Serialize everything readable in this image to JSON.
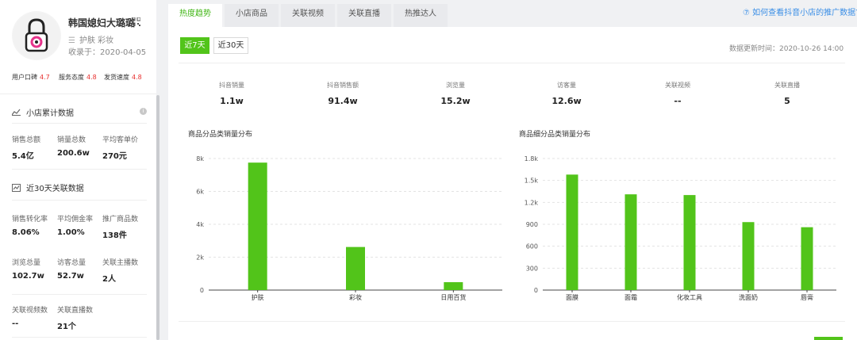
{
  "shop": {
    "name": "韩国媳妇大璐璐",
    "categories": "护肤 彩妆",
    "collected_date": "收录于：2020-04-05",
    "ratings": [
      {
        "label": "用户口碑",
        "value": "4.7"
      },
      {
        "label": "服务态度",
        "value": "4.8"
      },
      {
        "label": "发货速度",
        "value": "4.8"
      }
    ]
  },
  "cumulative": {
    "title": "小店累计数据",
    "metrics": [
      {
        "label": "销售总额",
        "value": "5.4亿"
      },
      {
        "label": "销量总数",
        "value": "200.6w"
      },
      {
        "label": "平均客单价",
        "value": "270元"
      }
    ]
  },
  "recent30": {
    "title": "近30天关联数据",
    "metrics": [
      {
        "label": "销售转化率",
        "value": "8.06%"
      },
      {
        "label": "平均佣金率",
        "value": "1.00%"
      },
      {
        "label": "推广商品数",
        "value": "138件"
      },
      {
        "label": "浏览总量",
        "value": "102.7w"
      },
      {
        "label": "访客总量",
        "value": "52.7w"
      },
      {
        "label": "关联主播数",
        "value": "2人"
      },
      {
        "label": "关联视频数",
        "value": "--"
      },
      {
        "label": "关联直播数",
        "value": "21个"
      }
    ]
  },
  "tabs": [
    "热度趋势",
    "小店商品",
    "关联视频",
    "关联直播",
    "热推达人"
  ],
  "help_link": "如何查看抖音小店的推广数据?",
  "periods": [
    "近7天",
    "近30天"
  ],
  "update_time": "数据更新时间：2020-10-26 14:00",
  "stats": [
    {
      "label": "抖音销量",
      "value": "1.1w"
    },
    {
      "label": "抖音销售额",
      "value": "91.4w"
    },
    {
      "label": "浏览量",
      "value": "15.2w"
    },
    {
      "label": "访客量",
      "value": "12.6w"
    },
    {
      "label": "关联视频",
      "value": "--"
    },
    {
      "label": "关联直播",
      "value": "5"
    }
  ],
  "colors": {
    "accent": "#52c41a",
    "rating": "#e8302f",
    "link": "#3a8ee6"
  },
  "chart_data": [
    {
      "type": "bar",
      "title": "商品分品类销量分布",
      "categories": [
        "护肤",
        "彩妆",
        "日用百货"
      ],
      "values": [
        7750,
        2620,
        480
      ],
      "ylim": [
        0,
        8000
      ],
      "yticks": [
        "0",
        "2k",
        "4k",
        "6k",
        "8k"
      ],
      "ytick_values": [
        0,
        2000,
        4000,
        6000,
        8000
      ],
      "grid": true
    },
    {
      "type": "bar",
      "title": "商品细分品类销量分布",
      "categories": [
        "面膜",
        "面霜",
        "化妆工具",
        "洗面奶",
        "唇膏"
      ],
      "values": [
        1580,
        1310,
        1300,
        930,
        860
      ],
      "ylim": [
        0,
        1800
      ],
      "yticks": [
        "0",
        "300",
        "600",
        "900",
        "1.2k",
        "1.5k",
        "1.8k"
      ],
      "ytick_values": [
        0,
        300,
        600,
        900,
        1200,
        1500,
        1800
      ],
      "grid": true
    }
  ]
}
